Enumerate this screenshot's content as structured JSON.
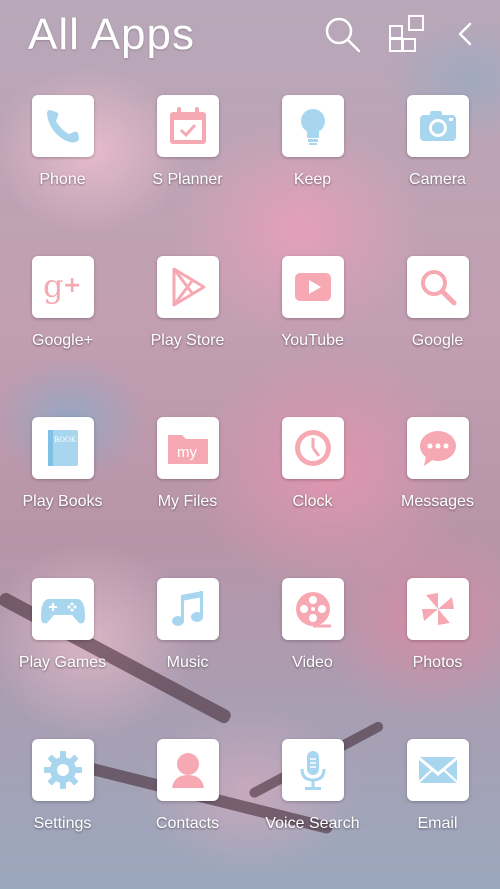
{
  "header": {
    "title": "All Apps",
    "icons": [
      "search-icon",
      "grid-icon",
      "back-icon"
    ]
  },
  "colors": {
    "blue": "#a9d6ef",
    "pink": "#f7a9b3",
    "blue_dark": "#7fc0e4"
  },
  "apps": [
    {
      "label": "Phone",
      "icon": "phone-icon"
    },
    {
      "label": "S Planner",
      "icon": "calendar-icon"
    },
    {
      "label": "Keep",
      "icon": "lightbulb-icon"
    },
    {
      "label": "Camera",
      "icon": "camera-icon"
    },
    {
      "label": "Google+",
      "icon": "google-plus-icon"
    },
    {
      "label": "Play Store",
      "icon": "play-store-icon"
    },
    {
      "label": "YouTube",
      "icon": "youtube-icon"
    },
    {
      "label": "Google",
      "icon": "google-search-icon"
    },
    {
      "label": "Play Books",
      "icon": "book-icon"
    },
    {
      "label": "My Files",
      "icon": "folder-icon"
    },
    {
      "label": "Clock",
      "icon": "clock-icon"
    },
    {
      "label": "Messages",
      "icon": "message-bubble-icon"
    },
    {
      "label": "Play Games",
      "icon": "gamepad-icon"
    },
    {
      "label": "Music",
      "icon": "music-note-icon"
    },
    {
      "label": "Video",
      "icon": "film-reel-icon"
    },
    {
      "label": "Photos",
      "icon": "pinwheel-icon"
    },
    {
      "label": "Settings",
      "icon": "gear-icon"
    },
    {
      "label": "Contacts",
      "icon": "contact-person-icon"
    },
    {
      "label": "Voice Search",
      "icon": "microphone-icon"
    },
    {
      "label": "Email",
      "icon": "envelope-icon"
    }
  ],
  "icon_text": {
    "book": "BOOK",
    "folder": "my"
  }
}
